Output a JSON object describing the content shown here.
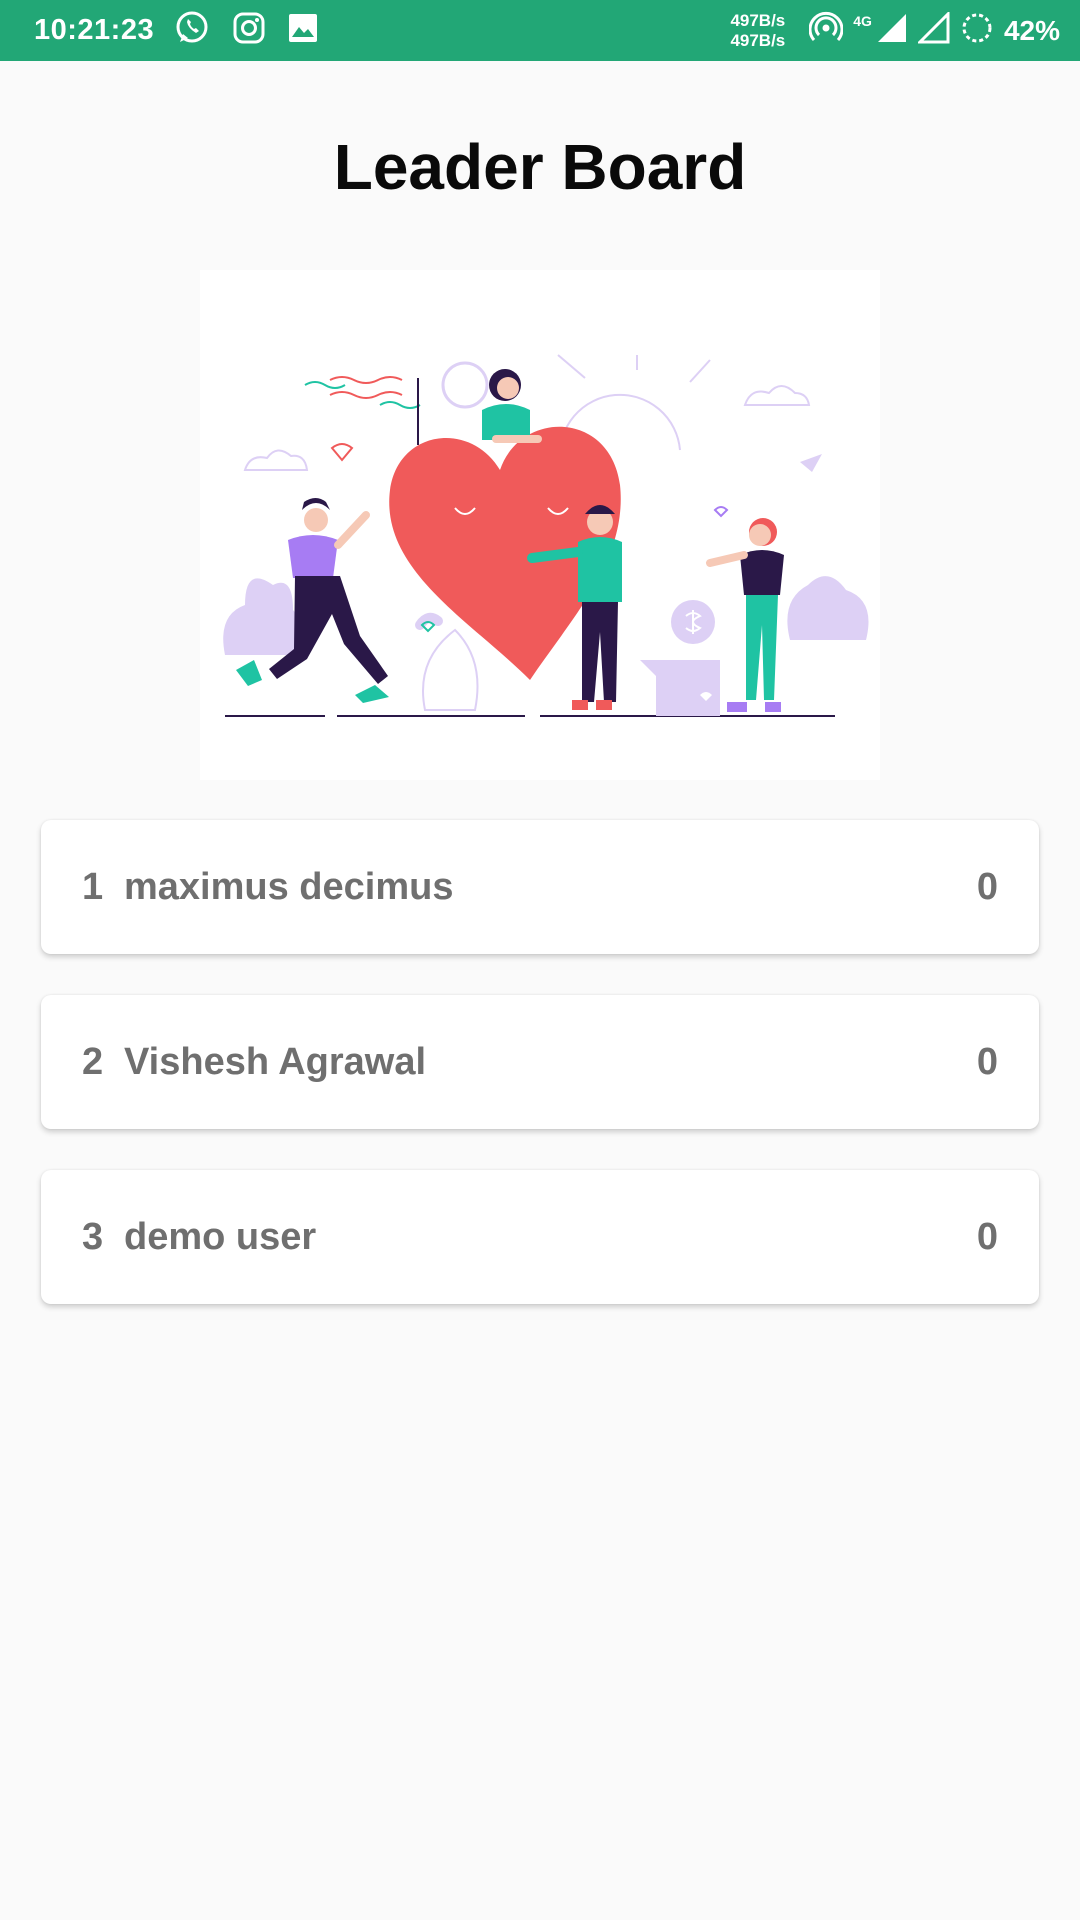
{
  "status_bar": {
    "time": "10:21:23",
    "speed_up": "497B/s",
    "speed_down": "497B/s",
    "network": "4G",
    "battery": "42%",
    "icons": [
      "whatsapp-icon",
      "instagram-icon",
      "gallery-icon",
      "hotspot-icon",
      "signal-4g-icon",
      "signal-icon",
      "battery-saver-icon"
    ]
  },
  "page": {
    "title": "Leader Board"
  },
  "illustration": {
    "name": "heart-people-illustration",
    "colors": {
      "heart": "#f05a5a",
      "teal": "#1fc3a3",
      "purple": "#a77cf3",
      "lavender": "#ddd0f5",
      "navy": "#2a1848"
    }
  },
  "leaderboard": {
    "entries": [
      {
        "rank": "1",
        "name": "maximus decimus",
        "score": "0"
      },
      {
        "rank": "2",
        "name": "Vishesh Agrawal",
        "score": "0"
      },
      {
        "rank": "3",
        "name": "demo user",
        "score": "0"
      }
    ]
  },
  "colors": {
    "status_bar": "#22a776",
    "background": "#fafafa",
    "card_text": "#6f6f6f"
  }
}
